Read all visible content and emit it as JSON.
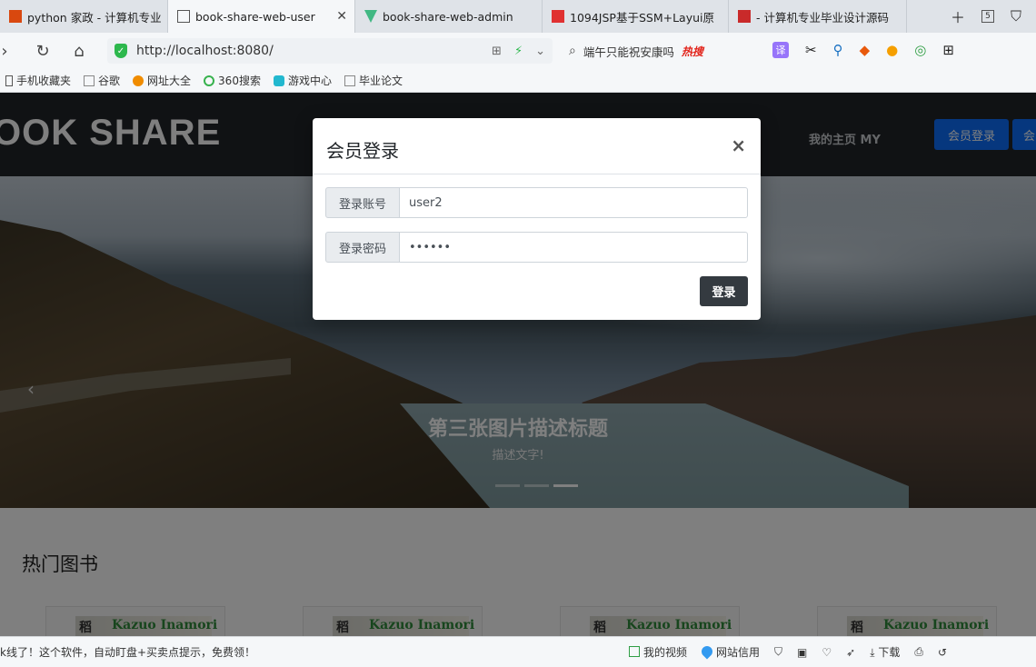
{
  "browser": {
    "tabs": [
      {
        "label": "python 家政 - 计算机专业",
        "favicon_color": "#d9480f"
      },
      {
        "label": "book-share-web-user",
        "favicon_color": "#555555",
        "active": true
      },
      {
        "label": "book-share-web-admin",
        "favicon_color": "#41b883"
      },
      {
        "label": "1094JSP基于SSM+Layui原",
        "favicon_color": "#e03131"
      },
      {
        "label": "- 计算机专业毕业设计源码",
        "favicon_color": "#c92a2a"
      }
    ],
    "tab_count": "5",
    "address": "http://localhost:8080/",
    "search_text": "端午只能祝安康吗",
    "search_hot": "热搜",
    "bookmarks": [
      "手机收藏夹",
      "谷歌",
      "网址大全",
      "360搜索",
      "游戏中心",
      "毕业论文"
    ]
  },
  "site": {
    "brand": "OOK SHARE",
    "nav_my": "我的主页 MY",
    "login_button": "会员登录",
    "register_button": "会",
    "carousel": {
      "title": "第三张图片描述标题",
      "text": "描述文字!",
      "active_index": 3
    },
    "section_title": "热门图书",
    "books": [
      {
        "glyph": "稻",
        "author": "Kazuo Inamori"
      },
      {
        "glyph": "稻",
        "author": "Kazuo Inamori"
      },
      {
        "glyph": "稻",
        "author": "Kazuo Inamori"
      },
      {
        "glyph": "稻",
        "author": "Kazuo Inamori"
      }
    ]
  },
  "modal": {
    "title": "会员登录",
    "close": "×",
    "account_label": "登录账号",
    "account_value": "user2",
    "password_label": "登录密码",
    "password_value": "123456",
    "submit": "登录"
  },
  "statusbar": {
    "ticker": "k线了！这个软件，自动盯盘+买卖点提示，免费领！",
    "items": [
      "我的视频",
      "网站信用",
      "下载"
    ]
  }
}
